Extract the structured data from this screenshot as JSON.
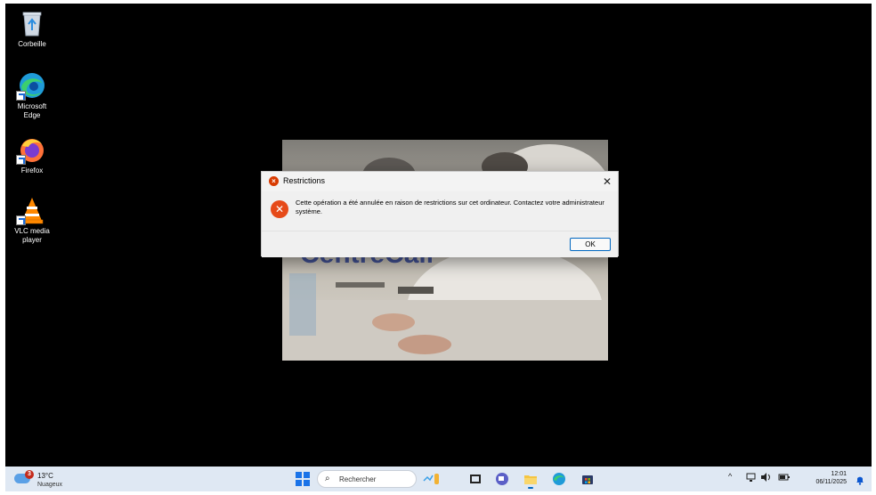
{
  "desktop": {
    "icons": [
      {
        "label": "Corbeille"
      },
      {
        "label": "Microsoft\nEdge"
      },
      {
        "label": "Firefox"
      },
      {
        "label": "VLC media\nplayer"
      }
    ]
  },
  "background_app": {
    "partial_text": "CentreCall"
  },
  "dialog": {
    "title": "Restrictions",
    "message": "Cette opération a été annulée en raison de restrictions sur cet ordinateur. Contactez votre administrateur système.",
    "ok_label": "OK",
    "close_glyph": "✕"
  },
  "taskbar": {
    "weather_badge": "3",
    "temperature": "13°C",
    "condition": "Nuageux",
    "search_placeholder": "Rechercher",
    "pinned_apps": [
      "start-icon",
      "widgets-icon",
      "task-view-icon",
      "chat-icon",
      "file-explorer-icon",
      "edge-icon",
      "store-icon"
    ],
    "tray_chevron": "^",
    "time": "12:01",
    "date": "06/11/2025"
  },
  "colors": {
    "error_red": "#e64a19",
    "taskbar_bg": "#dfe8f3",
    "accent_blue": "#0067c0"
  }
}
